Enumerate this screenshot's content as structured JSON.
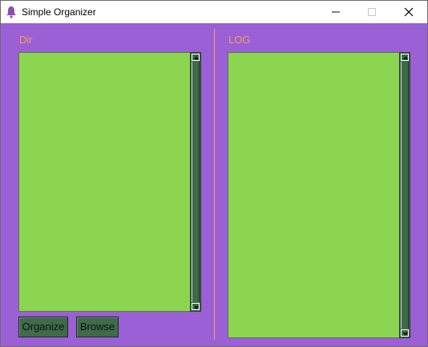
{
  "window": {
    "title": "Simple Organizer",
    "icon": "app-bell-icon",
    "controls": [
      "minimize-icon",
      "maximize-icon",
      "close-icon"
    ]
  },
  "left_panel": {
    "label": "Dir",
    "buttons": {
      "organize": "Organize",
      "browse": "Browse"
    }
  },
  "right_panel": {
    "label": "LOG"
  },
  "colors": {
    "background": "#9b5fd6",
    "label": "#f0a35c",
    "listbox": "#8bd551",
    "scrollbar_and_buttons": "#3e6b49"
  }
}
